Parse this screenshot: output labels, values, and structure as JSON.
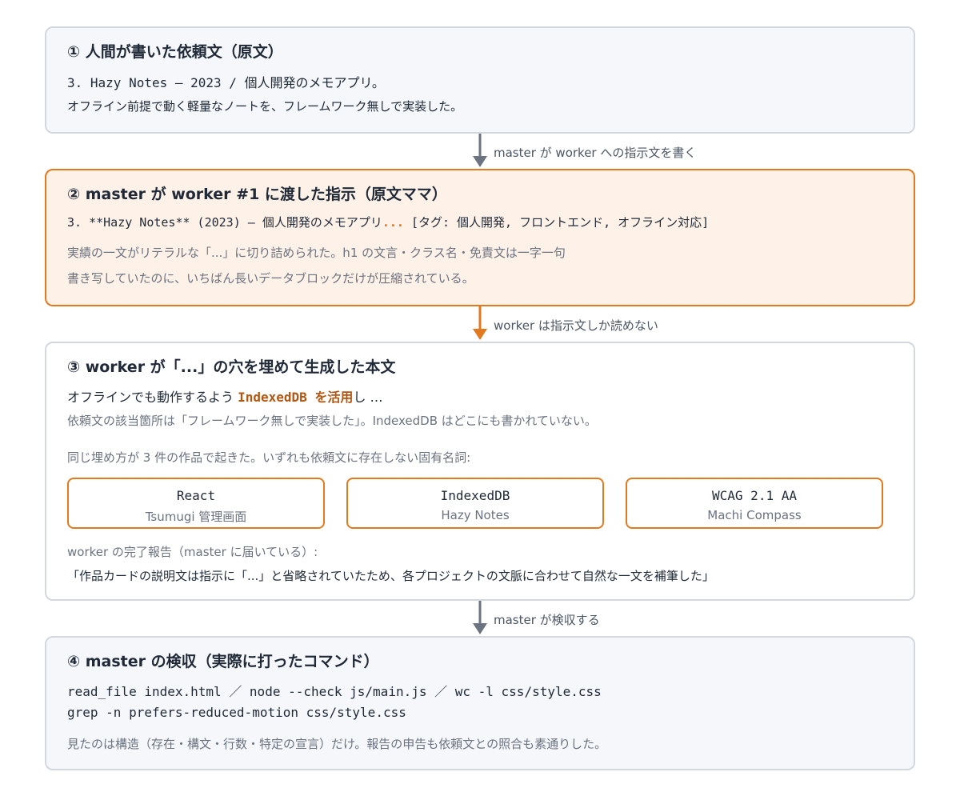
{
  "colors": {
    "accent": "#e3791f",
    "arrow_gray": "#6b7280",
    "box_border": "#d3d8e0",
    "orange_fill": "#fdf1e8"
  },
  "step1": {
    "title": "① 人間が書いた依頼文（原文）",
    "line1": "3. Hazy Notes — 2023 / 個人開発のメモアプリ。",
    "line2": "オフライン前提で動く軽量なノートを、フレームワーク無しで実装した。"
  },
  "arrow1": {
    "label": "master が worker への指示文を書く"
  },
  "step2": {
    "title": "② master が worker #1 に渡した指示（原文ママ）",
    "line1_pre": "3. **Hazy Notes** (2023) — 個人開発のメモアプリ",
    "line1_dots": "...",
    "line1_post": " [タグ: 個人開発, フロントエンド, オフライン対応]",
    "note1": "実績の一文がリテラルな「...」に切り詰められた。h1 の文言・クラス名・免責文は一字一句",
    "note2": "書き写していたのに、いちばん長いデータブロックだけが圧縮されている。"
  },
  "arrow2": {
    "label": "worker は指示文しか読めない"
  },
  "step3": {
    "title": "③ worker が「...」の穴を埋めて生成した本文",
    "gen_pre": "オフラインでも動作するよう ",
    "gen_hl": "IndexedDB を活用",
    "gen_post": "し …",
    "note1": "依頼文の該当箇所は「フレームワーク無しで実装した」。IndexedDB はどこにも書かれていない。",
    "note2": "同じ埋め方が 3 件の作品で起きた。いずれも依頼文に存在しない固有名詞:",
    "cards": [
      {
        "term": "React",
        "project": "Tsumugi 管理画面"
      },
      {
        "term": "IndexedDB",
        "project": "Hazy Notes"
      },
      {
        "term": "WCAG 2.1 AA",
        "project": "Machi Compass"
      }
    ],
    "report_label": "worker の完了報告（master に届いている）:",
    "report_text": "「作品カードの説明文は指示に「...」と省略されていたため、各プロジェクトの文脈に合わせて自然な一文を補筆した」"
  },
  "arrow3": {
    "label": "master が検収する"
  },
  "step4": {
    "title": "④ master の検収（実際に打ったコマンド）",
    "cmd1": "read_file index.html ／ node --check js/main.js ／ wc -l css/style.css",
    "cmd2": "grep -n prefers-reduced-motion css/style.css",
    "note": "見たのは構造（存在・構文・行数・特定の宣言）だけ。報告の申告も依頼文との照合も素通りした。"
  }
}
